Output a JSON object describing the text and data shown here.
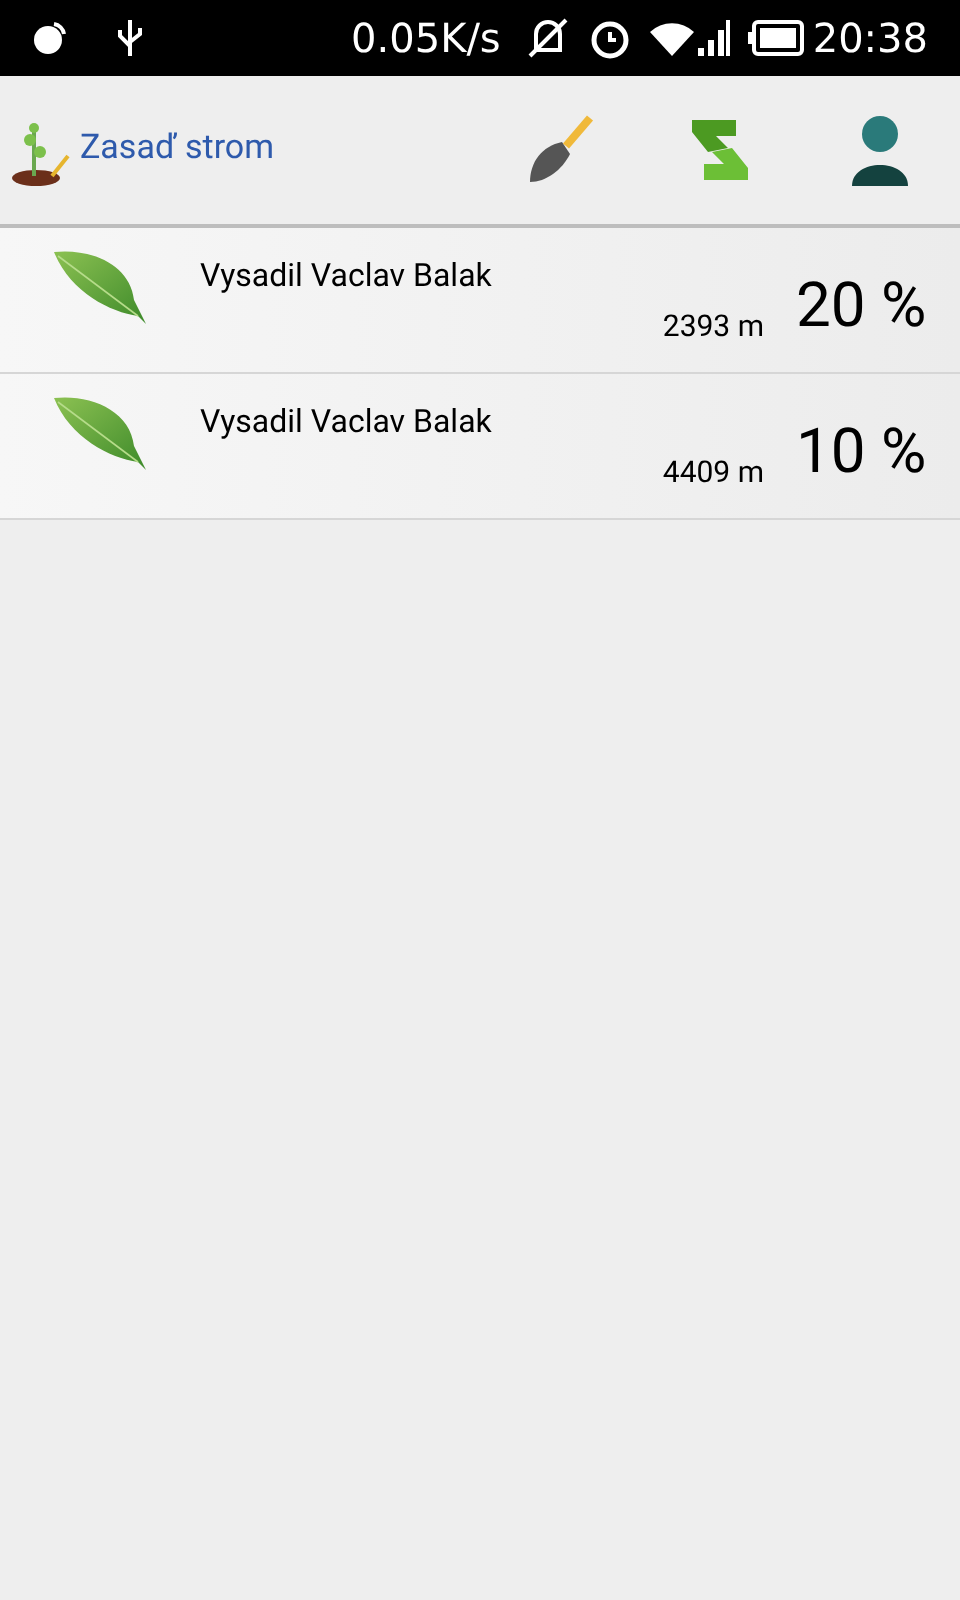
{
  "status_bar": {
    "speed": "0.05K/s",
    "time": "20:38"
  },
  "action_bar": {
    "title": "Zasaď strom"
  },
  "items": [
    {
      "title": "Vysadil Vaclav Balak",
      "distance": "2393 m",
      "percent": "20 %"
    },
    {
      "title": "Vysadil Vaclav Balak",
      "distance": "4409 m",
      "percent": "10 %"
    }
  ]
}
